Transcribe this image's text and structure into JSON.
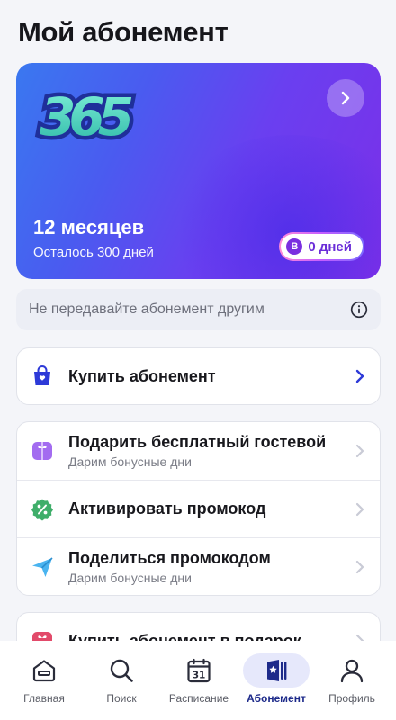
{
  "header": {
    "title": "Мой абонемент"
  },
  "subscription": {
    "logo_text": "365",
    "term": "12 месяцев",
    "remaining": "Осталось 300 дней",
    "bonus_badge_letter": "B",
    "bonus_days": "0 дней",
    "gradient": [
      "#3a78f0",
      "#7b2fe8"
    ]
  },
  "notice": {
    "text": "Не передавайте абонемент другим",
    "icon": "info-icon"
  },
  "buy_card": {
    "title": "Купить абонемент",
    "icon": "shopping-bag-icon"
  },
  "actions": [
    {
      "title": "Подарить бесплатный гостевой",
      "subtitle": "Дарим бонусные дни",
      "icon": "gift-icon"
    },
    {
      "title": "Активировать промокод",
      "subtitle": "",
      "icon": "percent-badge-icon"
    },
    {
      "title": "Поделиться промокодом",
      "subtitle": "Дарим бонусные дни",
      "icon": "send-plane-icon"
    }
  ],
  "partial_card": {
    "title": "Купить абонемент в подарок",
    "icon": "gift-box-icon"
  },
  "nav": {
    "items": [
      {
        "label": "Главная",
        "icon": "home-icon"
      },
      {
        "label": "Поиск",
        "icon": "search-icon"
      },
      {
        "label": "Расписание",
        "icon": "calendar-icon",
        "calendar_day": "31"
      },
      {
        "label": "Абонемент",
        "icon": "membership-card-icon",
        "active": true
      },
      {
        "label": "Профиль",
        "icon": "profile-icon"
      }
    ]
  },
  "colors": {
    "accent": "#2d3ad8",
    "active_nav": "#1d2a8a",
    "bonus": "#6b2ed8"
  }
}
